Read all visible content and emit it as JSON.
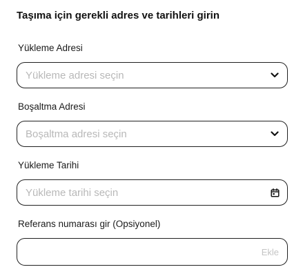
{
  "heading": "Taşıma için gerekli adres ve tarihleri girin",
  "fields": {
    "loading_address": {
      "label": "Yükleme Adresi",
      "placeholder": "Yükleme adresi seçin",
      "icon": "chevron-down-icon"
    },
    "unloading_address": {
      "label": "Boşaltma Adresi",
      "placeholder": "Boşaltma adresi seçin",
      "icon": "chevron-down-icon"
    },
    "loading_date": {
      "label": "Yükleme Tarihi",
      "placeholder": "Yükleme tarihi seçin",
      "icon": "calendar-icon"
    },
    "reference_number": {
      "label": "Referans numarası gir (Opsiyonel)",
      "value": "",
      "add_label": "Ekle"
    }
  },
  "colors": {
    "border": "#1f1f1f",
    "placeholder": "#b8b8b8",
    "add_button": "#c4c4c4",
    "text": "#1a1a1a"
  }
}
